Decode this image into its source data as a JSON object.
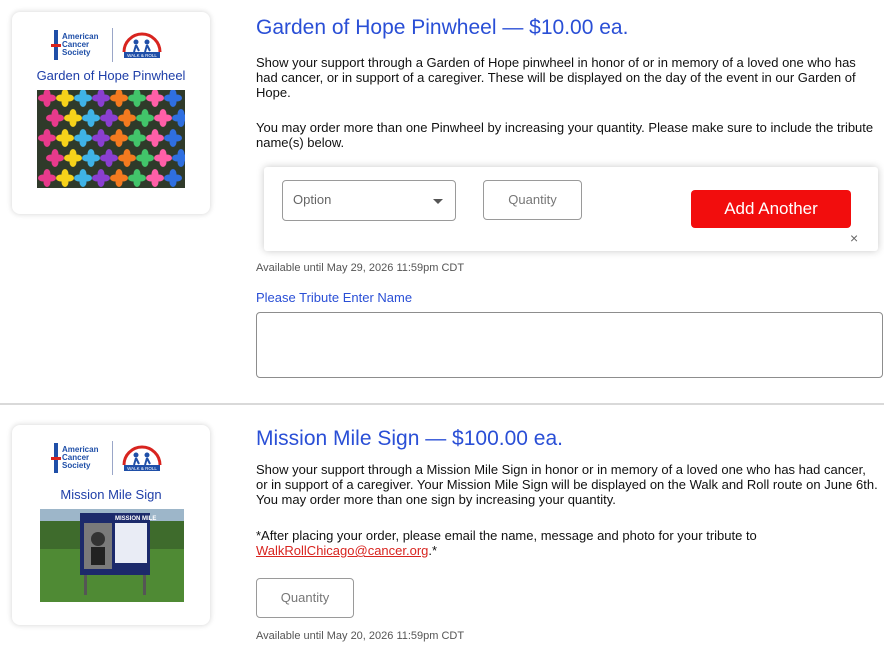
{
  "brand": {
    "acs_lines": [
      "American",
      "Cancer",
      "Society"
    ],
    "walk_logo_text": "WALK & ROLL"
  },
  "products": [
    {
      "card_title": "Garden of Hope Pinwheel",
      "title": "Garden of Hope Pinwheel — $10.00 ea.",
      "desc1": "Show your support through a Garden of Hope pinwheel in honor of or in memory of a loved one who has had cancer, or in support of a caregiver. These will be displayed on the day of the event in our Garden of Hope.",
      "desc2": "You may order more than one Pinwheel by increasing your quantity. Please make sure to include the tribute name(s) below.",
      "option_placeholder": "Option",
      "quantity_placeholder": "Quantity",
      "add_label": "Add Another",
      "close_label": "×",
      "available": "Available until May 29, 2026 11:59pm CDT",
      "tribute_label": "Please Tribute Enter Name",
      "tribute_value": ""
    },
    {
      "card_title": "Mission Mile Sign",
      "title": "Mission Mile Sign — $100.00 ea.",
      "desc1": "Show your support through a Mission Mile Sign in honor or in memory of a loved one who has had cancer, or in support of a caregiver. Your Mission Mile Sign will be displayed on the Walk and Roll route on June 6th. You may order more than one sign by increasing your quantity.",
      "desc2_prefix": "*After placing your order, please email the name, message and photo for your tribute to ",
      "email": "WalkRollChicago@cancer.org",
      "desc2_suffix": ".*",
      "sign_heading": "MISSION MILE",
      "quantity_placeholder": "Quantity",
      "available": "Available until May 20, 2026 11:59pm CDT"
    }
  ],
  "colors": {
    "accent_blue": "#2a4fd6",
    "add_red": "#f20d0d",
    "link_red": "#d8241f"
  }
}
